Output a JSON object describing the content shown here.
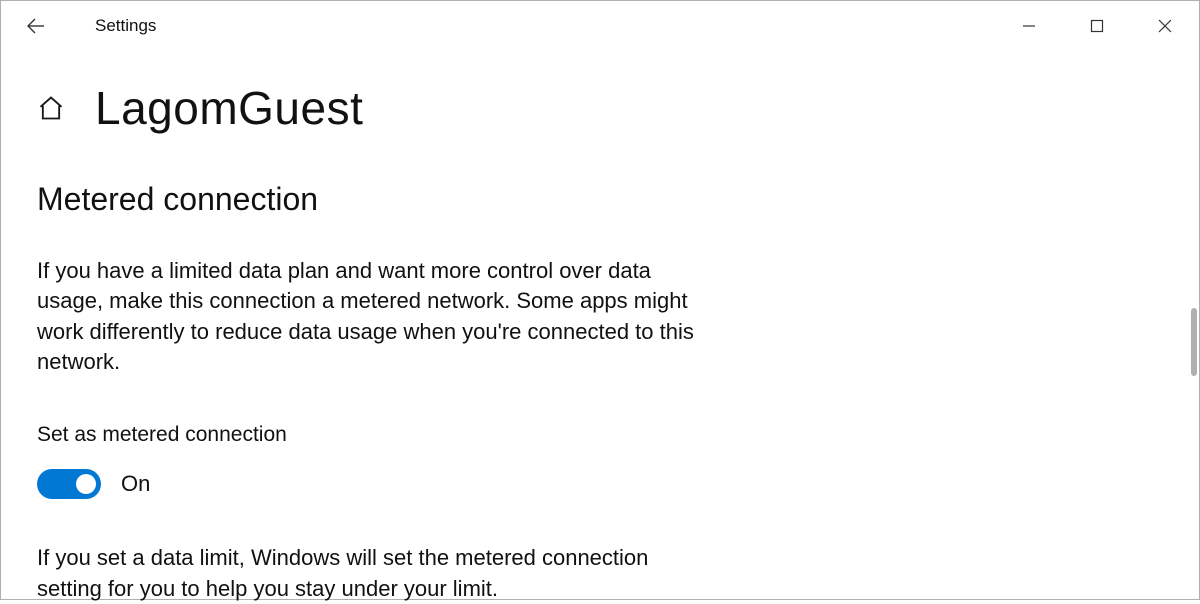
{
  "window": {
    "title": "Settings"
  },
  "header": {
    "page_title": "LagomGuest"
  },
  "section": {
    "title": "Metered connection",
    "description": "If you have a limited data plan and want more control over data usage, make this connection a metered network. Some apps might work differently to reduce data usage when you're connected to this network.",
    "toggle_label": "Set as metered connection",
    "toggle_state": "On",
    "hint": "If you set a data limit, Windows will set the metered connection setting for you to help you stay under your limit."
  },
  "colors": {
    "accent": "#0078d4"
  }
}
